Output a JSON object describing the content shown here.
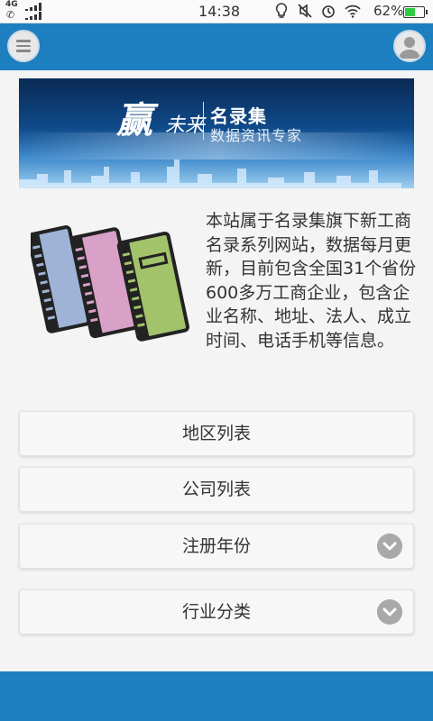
{
  "status_bar": {
    "network": "4G",
    "time": "14:38",
    "battery_percent": "62%",
    "battery_level": 0.62,
    "icons": [
      "bulb-icon",
      "mute-icon",
      "alarm-icon",
      "wifi-icon",
      "battery-icon"
    ]
  },
  "header": {
    "menu_icon": "menu-icon",
    "user_icon": "user-avatar-icon",
    "color": "#1e7fc0"
  },
  "banner": {
    "logo_main": "赢",
    "logo_sub": "未来",
    "brand_name": "名录集",
    "slogan": "数据资讯专家"
  },
  "intro": {
    "image_icon": "books-icon",
    "text": "本站属于名录集旗下新工商名录系列网站，数据每月更新，目前包含全国31个省份600多万工商企业，包含企业名称、地址、法人、成立时间、电话手机等信息。"
  },
  "menu": {
    "items": [
      {
        "label": "地区列表",
        "expandable": false
      },
      {
        "label": "公司列表",
        "expandable": false
      },
      {
        "label": "注册年份",
        "expandable": true
      },
      {
        "label": "行业分类",
        "expandable": true
      }
    ]
  },
  "colors": {
    "accent": "#1e7fc0",
    "background": "#f4f4f4",
    "chevron": "#a9a9a9"
  }
}
